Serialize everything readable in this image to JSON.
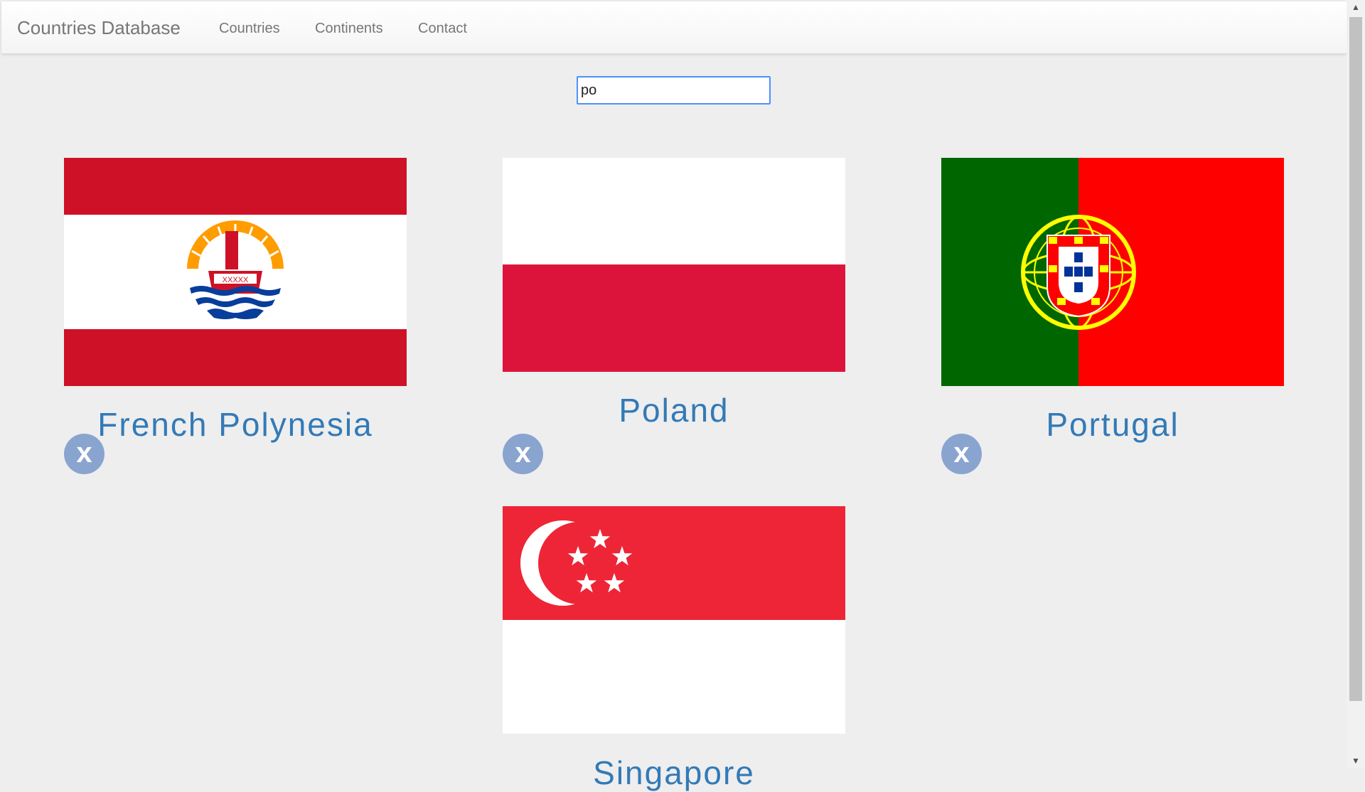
{
  "navbar": {
    "brand": "Countries Database",
    "links": [
      "Countries",
      "Continents",
      "Contact"
    ]
  },
  "search": {
    "value": "po"
  },
  "cards": [
    {
      "name": "French Polynesia",
      "remove_label": "x"
    },
    {
      "name": "Poland",
      "remove_label": "x"
    },
    {
      "name": "Portugal",
      "remove_label": "x"
    },
    {
      "name": "Singapore"
    }
  ],
  "colors": {
    "link": "#337ab7",
    "remove_button": "#8aa4d0",
    "background": "#eeeeee"
  }
}
